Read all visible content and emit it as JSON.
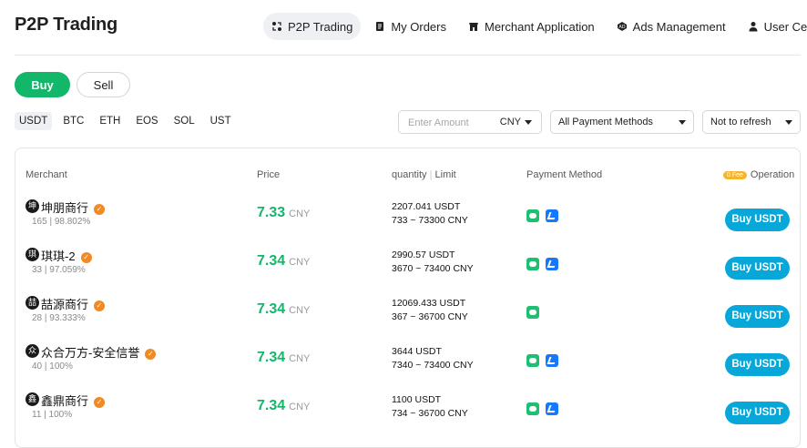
{
  "app": {
    "title": "P2P Trading"
  },
  "nav": [
    {
      "label": "P2P Trading",
      "icon": "p2p-icon",
      "active": true
    },
    {
      "label": "My Orders",
      "icon": "orders-icon"
    },
    {
      "label": "Merchant Application",
      "icon": "shop-icon"
    },
    {
      "label": "Ads Management",
      "icon": "ads-icon"
    },
    {
      "label": "User Center",
      "icon": "user-icon"
    }
  ],
  "trade": {
    "buy_label": "Buy",
    "sell_label": "Sell",
    "active": "Buy"
  },
  "coins": [
    "USDT",
    "BTC",
    "ETH",
    "EOS",
    "SOL",
    "UST"
  ],
  "active_coin": "USDT",
  "filters": {
    "amount_placeholder": "Enter Amount",
    "amount_currency": "CNY",
    "payment_method": "All Payment Methods",
    "refresh": "Not to refresh"
  },
  "table": {
    "headers": {
      "merchant": "Merchant",
      "price": "Price",
      "quantity": "quantity",
      "limit": "Limit",
      "payment": "Payment Method",
      "fee_badge": "0 Fee",
      "operation": "Operation"
    },
    "rows": [
      {
        "avatar": "坤",
        "name": "坤朋商行",
        "orders": "165",
        "completion": "98.802%",
        "price": "7.33",
        "currency": "CNY",
        "quantity": "2207.041 USDT",
        "limit": "733 ~ 73300 CNY",
        "payments": [
          "wechat-pay-icon",
          "alipay-icon"
        ],
        "button": "Buy USDT"
      },
      {
        "avatar": "琪",
        "name": "琪琪-2",
        "orders": "33",
        "completion": "97.059%",
        "price": "7.34",
        "currency": "CNY",
        "quantity": "2990.57 USDT",
        "limit": "3670 ~ 73400 CNY",
        "payments": [
          "wechat-pay-icon",
          "alipay-icon"
        ],
        "button": "Buy USDT"
      },
      {
        "avatar": "喆",
        "name": "喆源商行",
        "orders": "28",
        "completion": "93.333%",
        "price": "7.34",
        "currency": "CNY",
        "quantity": "12069.433 USDT",
        "limit": "367 ~ 36700 CNY",
        "payments": [
          "wechat-pay-icon"
        ],
        "button": "Buy USDT"
      },
      {
        "avatar": "众",
        "name": "众合万方-安全信誉",
        "orders": "40",
        "completion": "100%",
        "price": "7.34",
        "currency": "CNY",
        "quantity": "3644 USDT",
        "limit": "7340 ~ 73400 CNY",
        "payments": [
          "wechat-pay-icon",
          "alipay-icon"
        ],
        "button": "Buy USDT"
      },
      {
        "avatar": "鑫",
        "name": "鑫鼎商行",
        "orders": "11",
        "completion": "100%",
        "price": "7.34",
        "currency": "CNY",
        "quantity": "1100 USDT",
        "limit": "734 ~ 36700 CNY",
        "payments": [
          "wechat-pay-icon",
          "alipay-icon"
        ],
        "button": "Buy USDT"
      }
    ]
  },
  "colors": {
    "accent_green": "#12b76a",
    "button_blue": "#07a8d9",
    "verified_orange": "#f08a24",
    "fee_yellow": "#f7b52c"
  }
}
